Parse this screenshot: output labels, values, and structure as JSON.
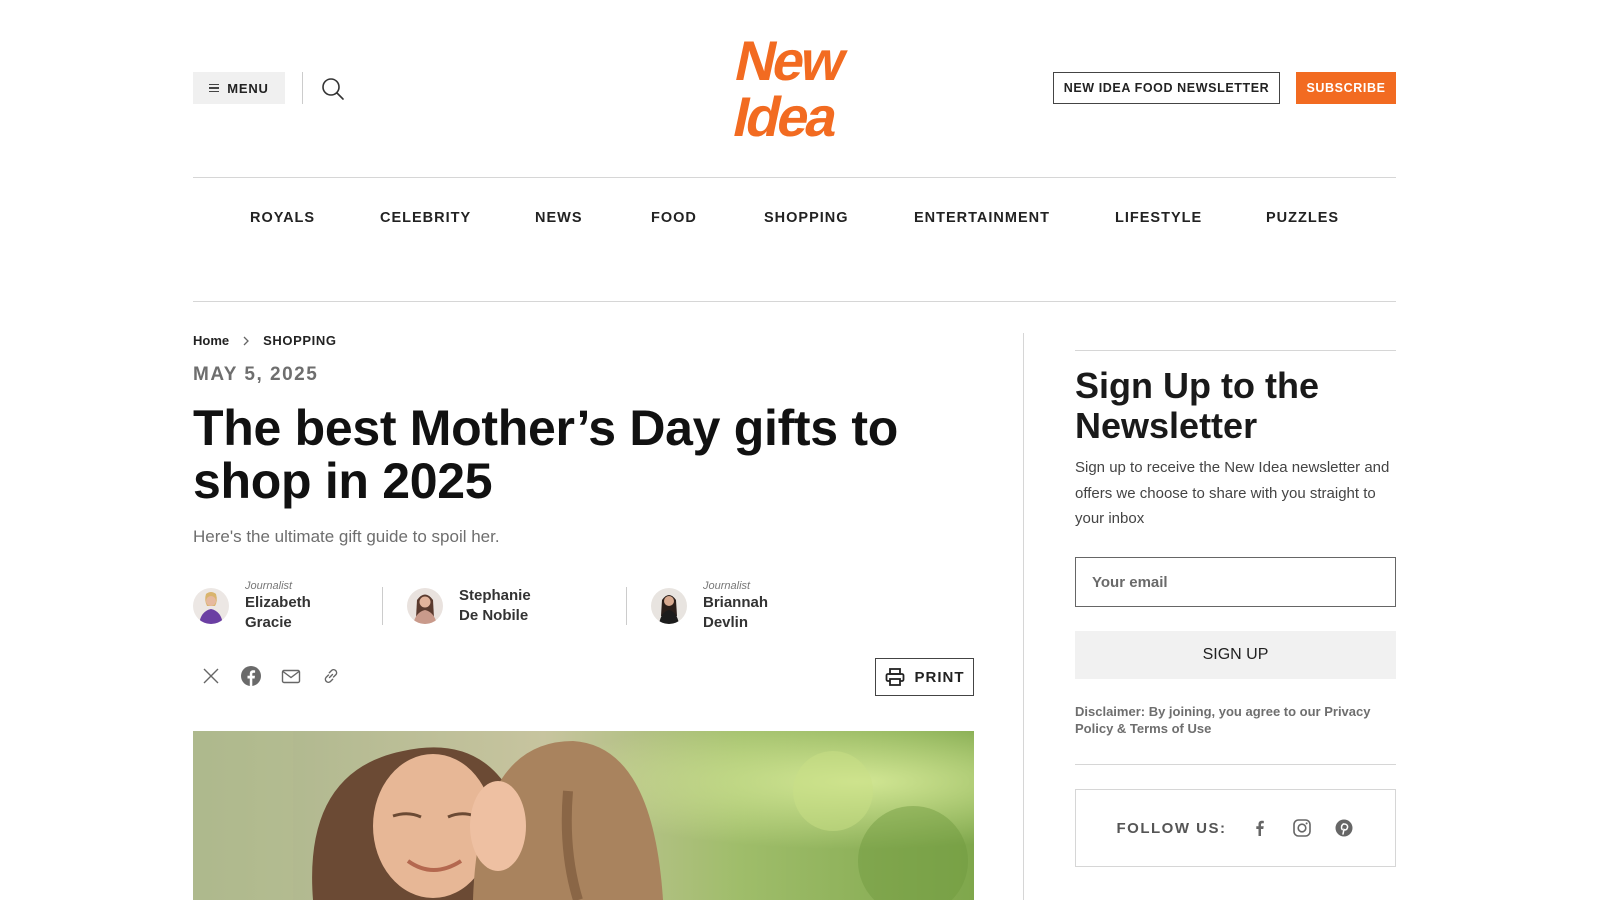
{
  "header": {
    "menu_label": "MENU",
    "logo_text_line1": "New",
    "logo_text_line2": "Idea",
    "newsletter_button": "NEW IDEA FOOD NEWSLETTER",
    "subscribe_button": "SUBSCRIBE",
    "accent_color": "#f26b21"
  },
  "nav": {
    "items": [
      "ROYALS",
      "CELEBRITY",
      "NEWS",
      "FOOD",
      "SHOPPING",
      "ENTERTAINMENT",
      "LIFESTYLE",
      "PUZZLES"
    ]
  },
  "breadcrumb": {
    "home": "Home",
    "current": "SHOPPING"
  },
  "article": {
    "date": "MAY 5, 2025",
    "title": "The best Mother’s Day gifts to shop in 2025",
    "dek": "Here's the ultimate gift guide to spoil her.",
    "authors": [
      {
        "role": "Journalist",
        "name": "Elizabeth Gracie"
      },
      {
        "role": "",
        "name": "Stephanie De Nobile"
      },
      {
        "role": "Journalist",
        "name": "Briannah Devlin"
      }
    ],
    "share_icons": [
      "x-icon",
      "facebook-icon",
      "email-icon",
      "link-icon"
    ],
    "print_label": "PRINT"
  },
  "sidebar": {
    "newsletter_heading": "Sign Up to the Newsletter",
    "newsletter_desc": "Sign up to receive the New Idea newsletter and offers we choose to share with you straight to your inbox",
    "email_placeholder": "Your email",
    "signup_button": "SIGN UP",
    "disclaimer": "Disclaimer: By joining, you agree to our Privacy Policy & Terms of Use",
    "follow_label": "FOLLOW US:",
    "social_icons": [
      "facebook-icon",
      "instagram-icon",
      "pinterest-icon"
    ]
  }
}
